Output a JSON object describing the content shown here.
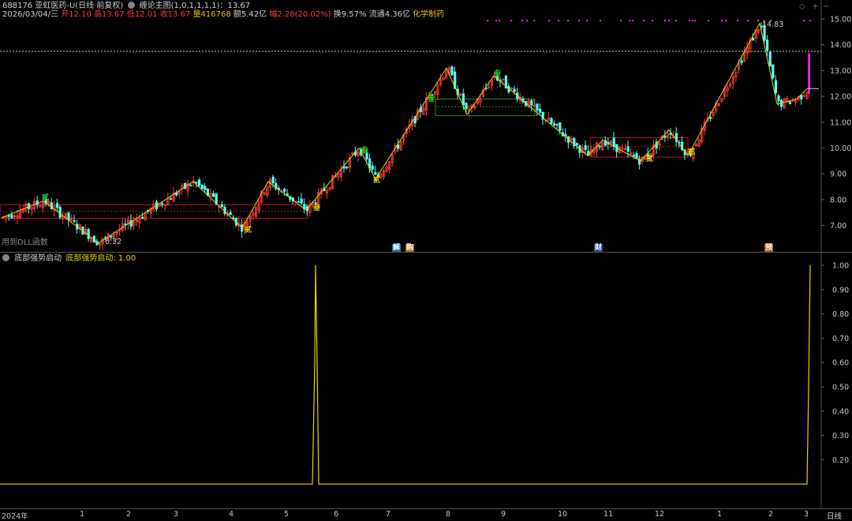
{
  "header": {
    "code": "688176 亚虹医药-U(日线 前复权)",
    "indicator": "缠论主图(1,0,1,1,1,1)：13.67",
    "date": "2026/03/04/三",
    "open_label": "开",
    "open": "12.10",
    "high_label": "高",
    "high": "13.67",
    "low_label": "低",
    "low": "12.01",
    "close_label": "收",
    "close": "13.67",
    "volume_label": "量",
    "volume": "416768",
    "amount_label": "额",
    "amount": "5.42亿",
    "change_label": "幅",
    "change": "2.28(20.02%)",
    "turnover": "换9.57%",
    "float_cap": "流通4.36亿",
    "sector": "化学制药"
  },
  "controls": {
    "diamond": "◇",
    "plus": "+",
    "minus": "−"
  },
  "main_chart": {
    "y_ticks": [
      "15.00",
      "14.00",
      "13.00",
      "12.00",
      "11.00",
      "10.00",
      "9.00",
      "8.00",
      "7.00"
    ],
    "low_marker": "6.32",
    "high_marker": "14.83",
    "bottom_label": "用到DLL函数",
    "stroke_labels": [
      "贰",
      "贰",
      "叁",
      "叁",
      "贰",
      "叁",
      "叁",
      "贰",
      "贰",
      "叁",
      "叁",
      "贰"
    ],
    "event_badges": [
      "解",
      "购",
      "财",
      "预"
    ]
  },
  "sub_chart": {
    "title": "底部强势启动",
    "value_label": "底部强势启动: 1.00",
    "y_ticks": [
      "1.00",
      "0.90",
      "0.80",
      "0.70",
      "0.60",
      "0.50",
      "0.40",
      "0.30",
      "0.20"
    ]
  },
  "x_axis": {
    "labels": [
      "2024年",
      "1",
      "2",
      "3",
      "4",
      "5",
      "6",
      "7",
      "8",
      "9",
      "10",
      "11",
      "12",
      "1",
      "2",
      "3"
    ],
    "period": "日线"
  },
  "colors": {
    "up": "#ff3b3b",
    "down": "#54ffff",
    "zigzag": "#e6d600",
    "hub_red": "#c01818",
    "hub_green": "#1a9a1a",
    "signal": "#e6d600",
    "magenta": "#e01ee0",
    "yellow_text": "#e6c200"
  },
  "chart_data": [
    {
      "type": "line",
      "title": "688176 亚虹医药-U(日线 前复权)",
      "y_range": [
        6.32,
        14.83
      ],
      "x_labels": [
        "2024年",
        "1",
        "2",
        "3",
        "4",
        "5",
        "6",
        "7",
        "8",
        "9",
        "10",
        "11",
        "12",
        "1",
        "2",
        "3"
      ],
      "zigzag_points": [
        {
          "x": "2024年",
          "y": 7.3
        },
        {
          "x": "1",
          "y": 7.95
        },
        {
          "x": "2",
          "y": 6.32
        },
        {
          "x": "3",
          "y": 8.7
        },
        {
          "x": "4",
          "y": 6.9
        },
        {
          "x": "4",
          "y": 8.7
        },
        {
          "x": "5",
          "y": 7.6
        },
        {
          "x": "6",
          "y": 10.0
        },
        {
          "x": "7",
          "y": 8.8
        },
        {
          "x": "8",
          "y": 13.1
        },
        {
          "x": "8",
          "y": 11.3
        },
        {
          "x": "9",
          "y": 12.8
        },
        {
          "x": "10",
          "y": 9.7
        },
        {
          "x": "11",
          "y": 10.3
        },
        {
          "x": "12",
          "y": 9.5
        },
        {
          "x": "12",
          "y": 10.7
        },
        {
          "x": "1",
          "y": 9.7
        },
        {
          "x": "2",
          "y": 14.83
        },
        {
          "x": "2",
          "y": 11.7
        },
        {
          "x": "3",
          "y": 12.3
        }
      ],
      "last_close": 13.67
    },
    {
      "type": "line",
      "title": "底部强势启动",
      "y_range": [
        0.1,
        1.0
      ],
      "series": [
        {
          "name": "底部强势启动",
          "spikes_at": [
            "5",
            "3"
          ],
          "value": 1.0
        }
      ]
    }
  ]
}
